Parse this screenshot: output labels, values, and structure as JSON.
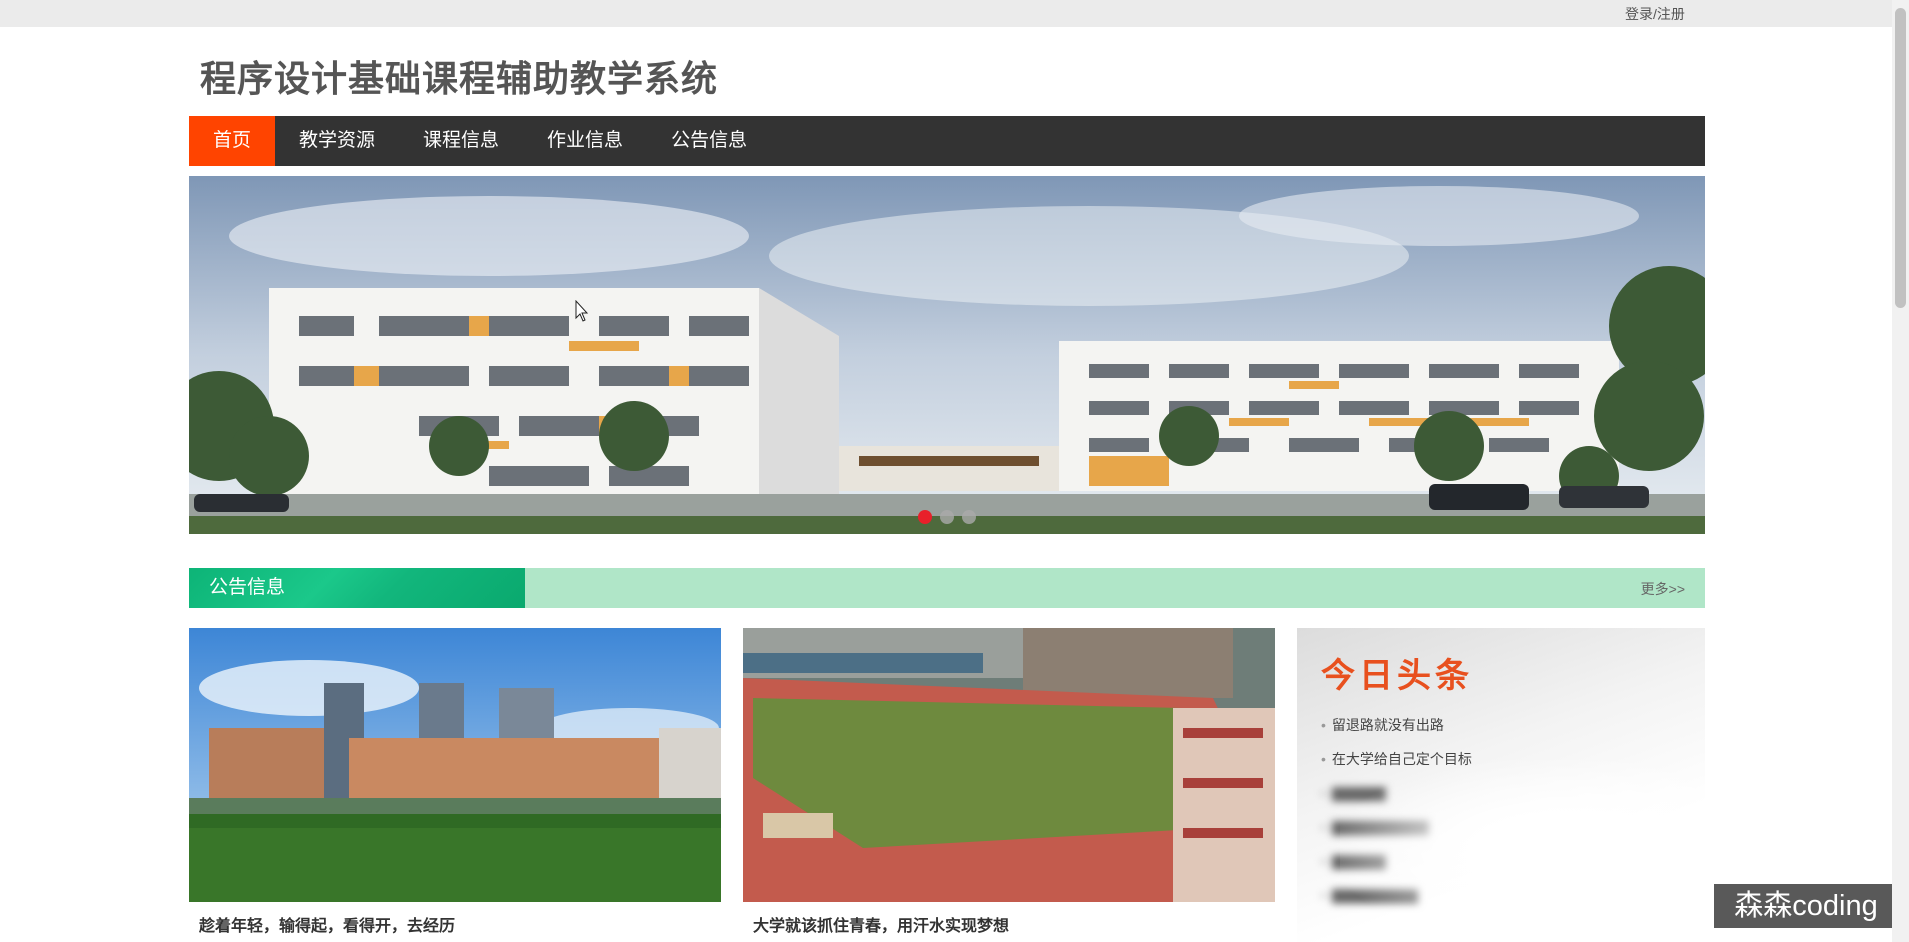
{
  "topbar": {
    "login_label": "登录/注册"
  },
  "site": {
    "title": "程序设计基础课程辅助教学系统"
  },
  "nav": {
    "items": [
      {
        "label": "首页",
        "active": true
      },
      {
        "label": "教学资源",
        "active": false
      },
      {
        "label": "课程信息",
        "active": false
      },
      {
        "label": "作业信息",
        "active": false
      },
      {
        "label": "公告信息",
        "active": false
      }
    ]
  },
  "banner": {
    "slide_count": 3,
    "active_slide": 1
  },
  "notice_section": {
    "title": "公告信息",
    "more_label": "更多>>"
  },
  "cards": [
    {
      "caption": "趁着年轻，输得起，看得开，去经历"
    },
    {
      "caption": "大学就该抓住青春，用汗水实现梦想"
    }
  ],
  "headlines": {
    "title": "今日头条",
    "items": [
      "留退路就没有出路",
      "在大学给自己定个目标"
    ]
  },
  "watermark": {
    "text": "森森coding"
  },
  "colors": {
    "nav_bg": "#333333",
    "nav_active": "#ff4400",
    "section_green": "#0db477",
    "section_light": "#b0e6c8",
    "headline_title": "#e8501e"
  }
}
